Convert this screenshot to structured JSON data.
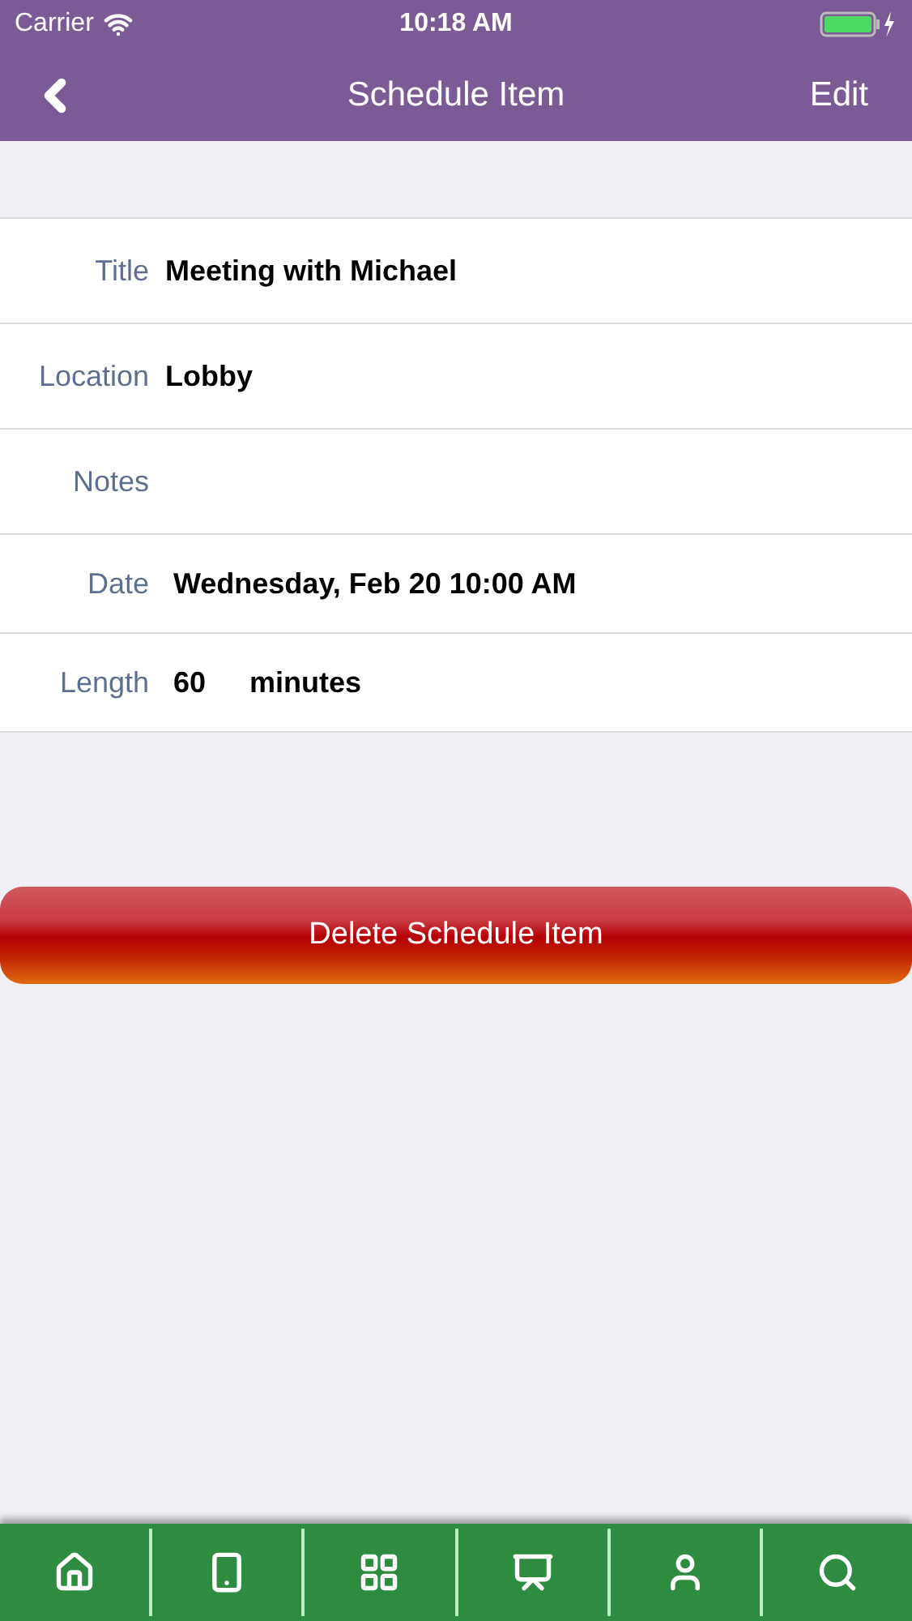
{
  "status_bar": {
    "carrier": "Carrier",
    "time": "10:18 AM"
  },
  "nav_bar": {
    "title": "Schedule Item",
    "action": "Edit"
  },
  "fields": [
    {
      "kind": "text",
      "label": "Title",
      "value": "Meeting with Michael"
    },
    {
      "kind": "text",
      "label": "Location",
      "value": "Lobby"
    },
    {
      "kind": "text",
      "label": "Notes"
    },
    {
      "kind": "text",
      "label": "Date",
      "value": "Wednesday, Feb 20 10:00 AM"
    },
    {
      "kind": "amount",
      "label": "Length",
      "value": "60",
      "unit": "minutes"
    }
  ],
  "delete_button": "Delete Schedule Item",
  "tab_bar": [
    {
      "kind": "home"
    },
    {
      "kind": "phone"
    },
    {
      "kind": "grid"
    },
    {
      "kind": "board"
    },
    {
      "kind": "speaker"
    },
    {
      "kind": "search"
    }
  ]
}
